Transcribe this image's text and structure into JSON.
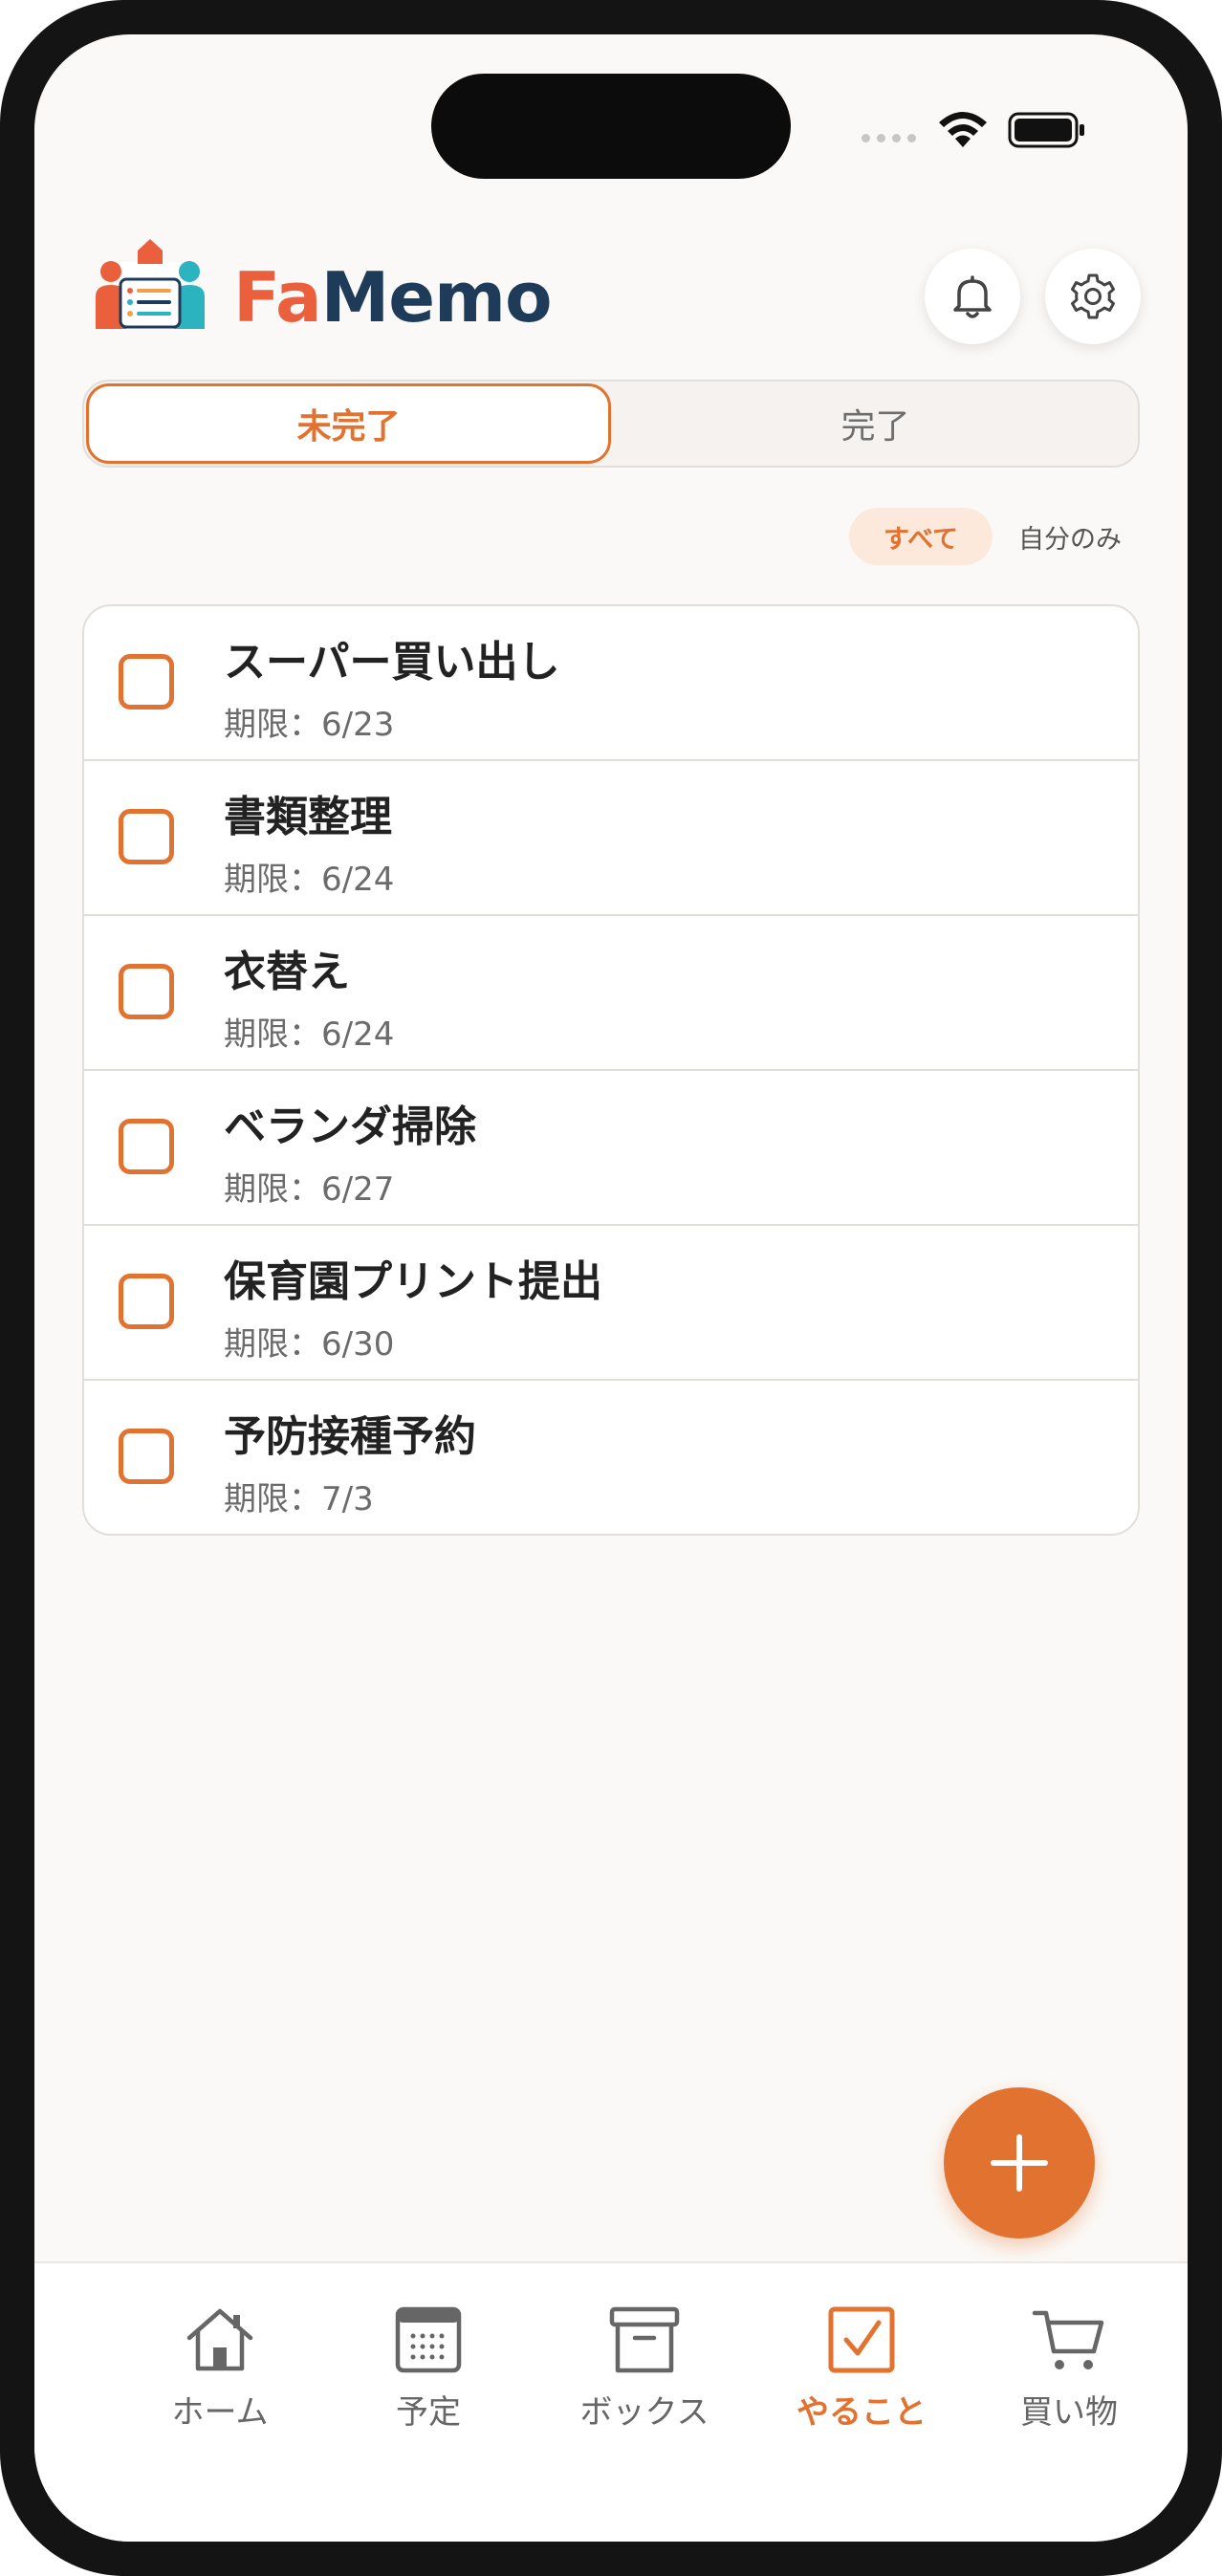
{
  "app": {
    "brand_fa": "Fa",
    "brand_memo": "Memo"
  },
  "colors": {
    "accent": "#e2722f",
    "brand_red": "#ea5f3c",
    "brand_navy": "#1f3b5a"
  },
  "segment": {
    "incomplete": "未完了",
    "complete": "完了",
    "selected": "未完了"
  },
  "filter": {
    "all": "すべて",
    "self_only": "自分のみ",
    "selected": "すべて"
  },
  "tasks": [
    {
      "title": "スーパー買い出し",
      "due": "期限：6/23",
      "done": false
    },
    {
      "title": "書類整理",
      "due": "期限：6/24",
      "done": false
    },
    {
      "title": "衣替え",
      "due": "期限：6/24",
      "done": false
    },
    {
      "title": "ベランダ掃除",
      "due": "期限：6/27",
      "done": false
    },
    {
      "title": "保育園プリント提出",
      "due": "期限：6/30",
      "done": false
    },
    {
      "title": "予防接種予約",
      "due": "期限：7/3",
      "done": false
    }
  ],
  "tabbar": {
    "items": [
      {
        "label": "ホーム",
        "icon": "home-icon"
      },
      {
        "label": "予定",
        "icon": "calendar-icon"
      },
      {
        "label": "ボックス",
        "icon": "box-icon"
      },
      {
        "label": "やること",
        "icon": "checkbox-icon"
      },
      {
        "label": "買い物",
        "icon": "cart-icon"
      }
    ],
    "active": "やること"
  },
  "icons": {
    "bell": "bell-icon",
    "settings": "gear-icon",
    "add": "plus-icon"
  }
}
